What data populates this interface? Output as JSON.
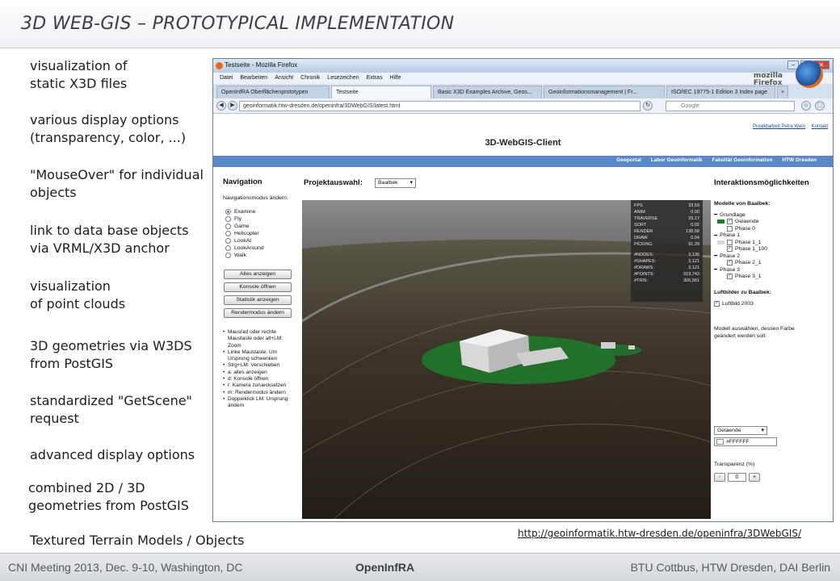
{
  "slide": {
    "title": "3D WEB-GIS – PROTOTYPICAL IMPLEMENTATION",
    "bullets": [
      "visualization of\nstatic X3D files",
      "various display options\n(transparency, color, ...)",
      "\"MouseOver\" for individual\nobjects",
      "link to data base objects\nvia VRML/X3D anchor",
      "visualization\nof point clouds",
      "3D geometries via W3DS\nfrom PostGIS",
      "standardized \"GetScene\"\nrequest",
      "advanced display options",
      "combined 2D / 3D\ngeometries from PostGIS",
      "Textured Terrain Models / Objects"
    ],
    "url": "http://geoinformatik.htw-dresden.de/openinfra/3DWebGIS/",
    "footer": {
      "left": "CNI Meeting 2013, Dec. 9-10, Washington, DC",
      "center": "OpenInfRA",
      "right": "BTU Cottbus, HTW Dresden, DAI Berlin"
    }
  },
  "browser": {
    "window_title": "Testseite - Mozilla Firefox",
    "menu": [
      "Datei",
      "Bearbeiten",
      "Ansicht",
      "Chronik",
      "Lesezeichen",
      "Extras",
      "Hilfe"
    ],
    "brand": "mozilla\nFirefox",
    "tabs": [
      "OpenInfRA Oberflächenprototypen",
      "Testseite",
      "Basic X3D Examples Archive, Geos...",
      "Geoinformationsmanagement | Fr...",
      "ISO/IEC 19775-1 Edition 3 Index page"
    ],
    "tab_plus": "+",
    "address": "geoinformatik.htw-dresden.de/openinfra/3DWebGIS/latest.html",
    "search_placeholder": "Google"
  },
  "webpage": {
    "top_links": [
      "Projektarbeit Petra Wein",
      "Kontakt"
    ],
    "title": "3D-WebGIS-Client",
    "nav_links": [
      "Geoportal",
      "Labor Geoinformatik",
      "Fakultät Geoinformation",
      "HTW Dresden"
    ],
    "navigation": {
      "heading": "Navigation",
      "mode_label": "Navigationsmodus ändern:",
      "modes": [
        "Examine",
        "Fly",
        "Game",
        "Helicopter",
        "LookAt",
        "LookAround",
        "Walk"
      ],
      "selected_mode": "Examine",
      "buttons": [
        "Alles anzeigen",
        "Konsole öffnen",
        "Statistik anzeigen",
        "Rendermodus ändern"
      ],
      "help": [
        "Mausrad oder rechte Maustaste oder alt+LM: Zoom",
        "Linke Maustaste: Um Ursprung schwenken",
        "Strg+LM: Verschieben",
        "a: alles anzeigen",
        "d: Konsole öffnen",
        "r: Kamera zuruecksetzen",
        "m: Rendermodus ändern",
        "Doppelklick LM: Ursprung ändern"
      ]
    },
    "project": {
      "label": "Projektauswahl:",
      "value": "Baalbek"
    },
    "stats": [
      [
        "FPS",
        "33.59"
      ],
      [
        "ANIM",
        "0.00"
      ],
      [
        "TRAVERSE",
        "29.17"
      ],
      [
        "SORT",
        "0.02"
      ],
      [
        "RENDER",
        "138.58"
      ],
      [
        "DRAW",
        "0.04"
      ],
      [
        "PICKING",
        "91.29"
      ],
      [
        "#NODES:",
        "3,135"
      ],
      [
        "#SHAPES:",
        "3,121"
      ],
      [
        "#DRAWS:",
        "3,121"
      ],
      [
        "#POINTS:",
        "919,743"
      ],
      [
        "#TRIS:",
        "306,581"
      ]
    ],
    "interactions": {
      "heading": "Interaktionsmöglichkeiten",
      "models_heading": "Modelle von Baalbek:",
      "tree": [
        {
          "label": "Grundlage",
          "group": true
        },
        {
          "label": "Gelaende",
          "checked": true,
          "swatch": "#1e7b2c"
        },
        {
          "label": "Phase 0",
          "checked": false
        },
        {
          "label": "Phase 1",
          "group": true
        },
        {
          "label": "Phase 1_1",
          "checked": false,
          "swatch": "#d8d8d8"
        },
        {
          "label": "Phase 1_100",
          "checked": true
        },
        {
          "label": "Phase 2",
          "group": true
        },
        {
          "label": "Phase 2_1",
          "checked": true
        },
        {
          "label": "Phase 3",
          "group": true
        },
        {
          "label": "Phase 3_1",
          "checked": true
        }
      ],
      "aerial_heading": "Luftbilder zu Baalbek:",
      "aerial_item": "Luftbild 2003",
      "color_prompt": "Modell auswählen, dessen Farbe geändert werden soll:",
      "model_select": "Gelaende",
      "color_value": "#FFFFFF",
      "transparency_label": "Transparenz (%)",
      "transparency_value": "0",
      "minus": "-",
      "plus": "+"
    }
  },
  "colors": {
    "accent": "#5b87c5",
    "terrain": "#352f26",
    "grass": "#1e7b2c"
  }
}
